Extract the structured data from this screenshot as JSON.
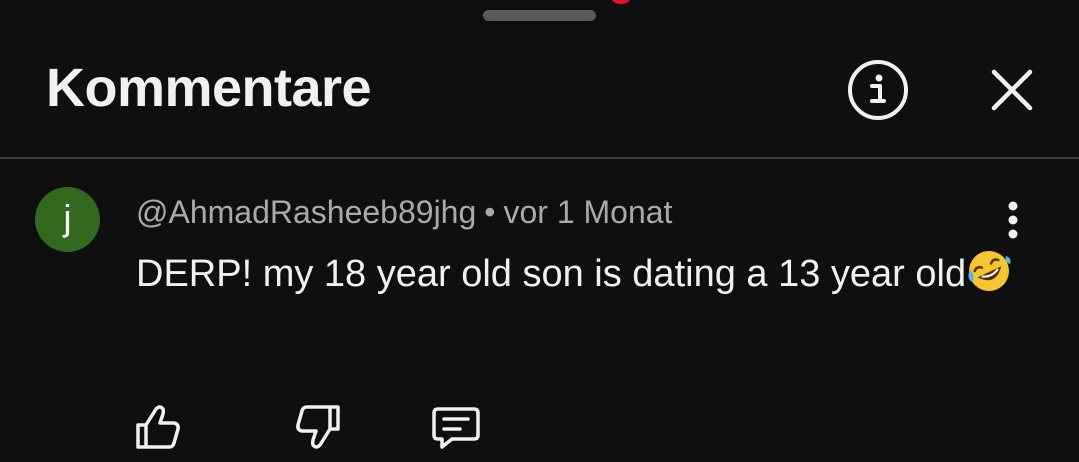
{
  "header": {
    "title": "Kommentare",
    "icons": {
      "info": "info-circle-icon",
      "close": "close-icon"
    }
  },
  "comment": {
    "avatar_letter": "j",
    "avatar_color": "#33691e",
    "author": "@AhmadRasheeb89jhg",
    "separator": "•",
    "time": "vor 1 Monat",
    "text": "DERP! my 18 year old son is dating a 13 year old",
    "emoji": "rolling-on-the-floor-laughing-emoji",
    "actions": {
      "like": "thumbs-up-icon",
      "dislike": "thumbs-down-icon",
      "reply": "reply-comment-icon",
      "more": "more-vertical-icon"
    }
  },
  "colors": {
    "background": "#0f0f0f",
    "text_primary": "#f1f1f1",
    "text_secondary": "#aaaaaa",
    "divider": "#3d3d3d",
    "notification_dot": "#e8112d"
  }
}
